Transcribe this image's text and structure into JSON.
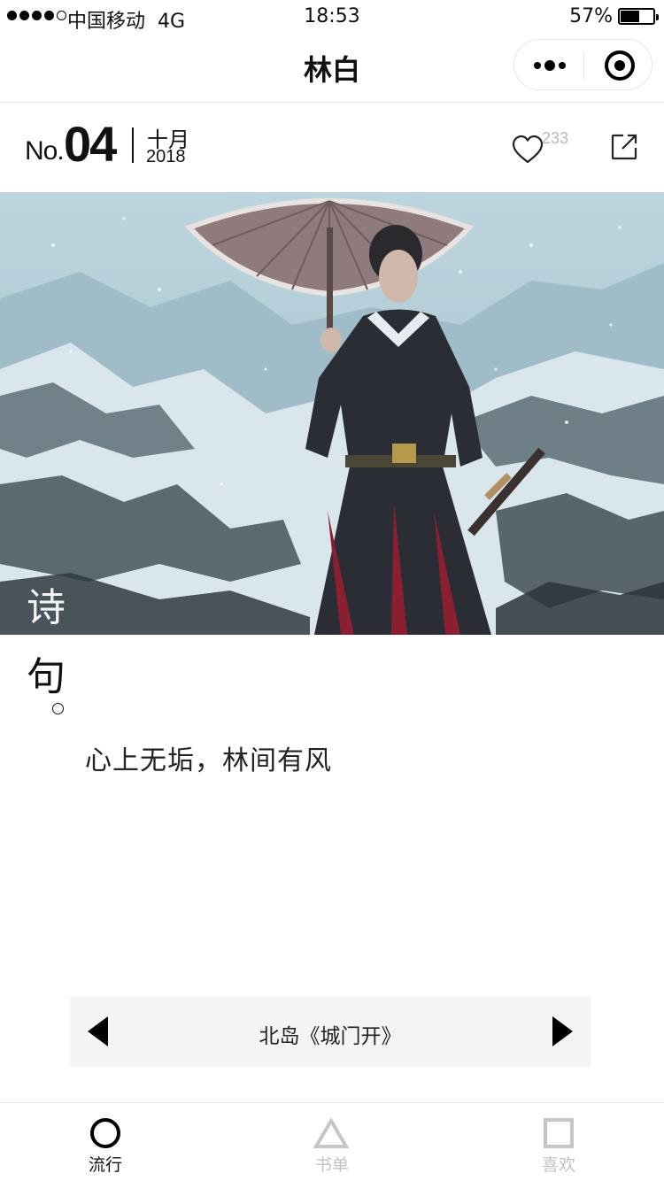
{
  "status_bar": {
    "carrier": "中国移动",
    "network": "4G",
    "time": "18:53",
    "battery_percent": "57%"
  },
  "nav": {
    "title": "林白"
  },
  "issue": {
    "no_label": "No.",
    "number": "04",
    "month": "十月",
    "year": "2018",
    "like_count": "233"
  },
  "poem": {
    "label_1": "诗",
    "label_2": "句",
    "verse": "心上无垢，林间有风",
    "source": "北岛《城门开》"
  },
  "tabs": [
    {
      "label": "流行",
      "icon": "circle-icon",
      "active": true
    },
    {
      "label": "书单",
      "icon": "triangle-icon",
      "active": false
    },
    {
      "label": "喜欢",
      "icon": "square-icon",
      "active": false
    }
  ],
  "colors": {
    "active": "#111111",
    "inactive": "#c2c2c2",
    "author_bar_bg": "#f4f4f4",
    "like_count": "#b8b8b8"
  }
}
